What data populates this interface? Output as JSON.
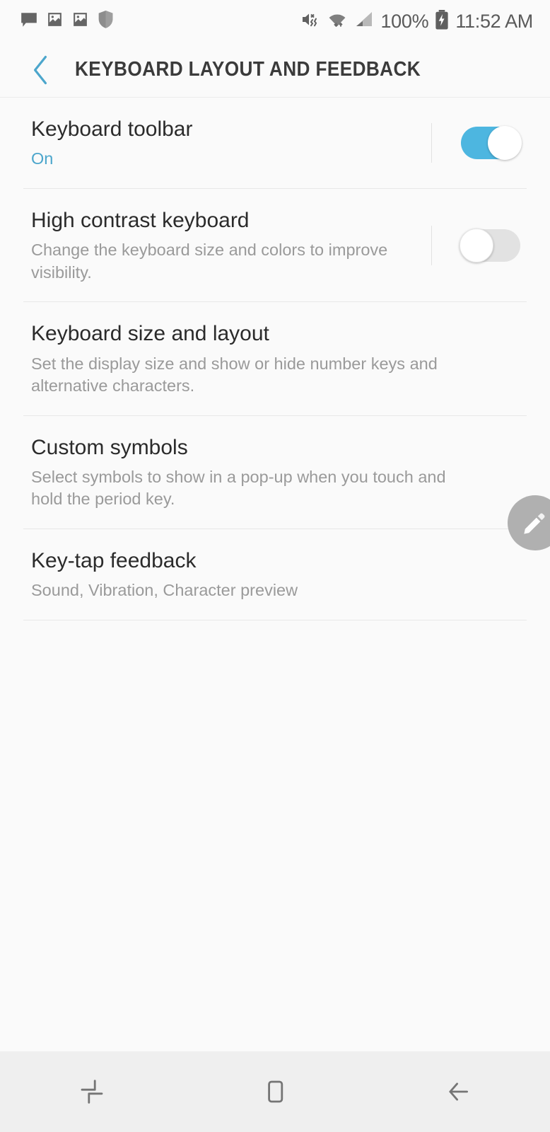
{
  "status_bar": {
    "left_icons": [
      {
        "name": "message-icon",
        "label": "Message"
      },
      {
        "name": "image-icon",
        "label": "Image"
      },
      {
        "name": "image-icon-2",
        "label": "Image"
      },
      {
        "name": "shield-icon",
        "label": "Security"
      }
    ],
    "right_icons": [
      {
        "name": "mute-vibrate-icon",
        "label": "Sound off"
      },
      {
        "name": "wifi-icon",
        "label": "Wi-Fi"
      },
      {
        "name": "signal-icon",
        "label": "Signal"
      }
    ],
    "battery_percent": "100%",
    "battery_icon": "battery-charging-icon",
    "time": "11:52 AM"
  },
  "header": {
    "back_icon": "chevron-left-icon",
    "title": "KEYBOARD LAYOUT AND FEEDBACK",
    "accent_color": "#4ca6cc"
  },
  "settings": {
    "rows": [
      {
        "title": "Keyboard toolbar",
        "subtitle": "On",
        "subtitle_accent": true,
        "has_toggle": true,
        "toggle_on": true,
        "name": "keyboard-toolbar"
      },
      {
        "title": "High contrast keyboard",
        "subtitle": "Change the keyboard size and colors to improve visibility.",
        "subtitle_accent": false,
        "has_toggle": true,
        "toggle_on": false,
        "name": "high-contrast-keyboard"
      },
      {
        "title": "Keyboard size and layout",
        "subtitle": "Set the display size and show or hide number keys and alternative characters.",
        "subtitle_accent": false,
        "has_toggle": false,
        "toggle_on": false,
        "name": "keyboard-size-and-layout"
      },
      {
        "title": "Custom symbols",
        "subtitle": "Select symbols to show in a pop-up when you touch and hold the period key.",
        "subtitle_accent": false,
        "has_toggle": false,
        "toggle_on": false,
        "name": "custom-symbols"
      },
      {
        "title": "Key-tap feedback",
        "subtitle": "Sound, Vibration, Character preview",
        "subtitle_accent": false,
        "has_toggle": false,
        "toggle_on": false,
        "name": "key-tap-feedback"
      }
    ]
  },
  "fab": {
    "icon": "edit-pencil-icon",
    "color": "#b0b0b0"
  },
  "nav_bar": {
    "buttons": [
      {
        "name": "recents-button",
        "icon": "recents-icon"
      },
      {
        "name": "home-button",
        "icon": "home-icon"
      },
      {
        "name": "back-button",
        "icon": "back-arrow-icon"
      }
    ]
  }
}
